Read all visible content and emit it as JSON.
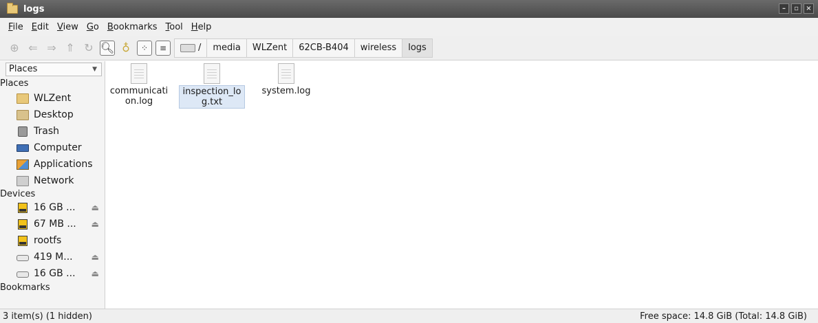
{
  "window": {
    "title": "logs"
  },
  "menu": [
    "File",
    "Edit",
    "View",
    "Go",
    "Bookmarks",
    "Tool",
    "Help"
  ],
  "menu_mnemonics": [
    "F",
    "E",
    "V",
    "G",
    "B",
    "T",
    "H"
  ],
  "breadcrumbs": [
    "/",
    "media",
    "WLZent",
    "62CB-B404",
    "wireless",
    "logs"
  ],
  "sidebar": {
    "selector": "Places",
    "places_header": "Places",
    "places": [
      {
        "label": "WLZent",
        "icon": "home-folder-icon"
      },
      {
        "label": "Desktop",
        "icon": "desktop-folder-icon"
      },
      {
        "label": "Trash",
        "icon": "trash-icon"
      },
      {
        "label": "Computer",
        "icon": "computer-icon"
      },
      {
        "label": "Applications",
        "icon": "applications-icon"
      },
      {
        "label": "Network",
        "icon": "network-folder-icon"
      }
    ],
    "devices_header": "Devices",
    "devices": [
      {
        "label": "16 GB ...",
        "icon": "usb-drive-icon",
        "eject": true
      },
      {
        "label": "67 MB ...",
        "icon": "usb-drive-icon",
        "eject": true
      },
      {
        "label": "rootfs",
        "icon": "usb-drive-icon",
        "eject": false
      },
      {
        "label": "419 M...",
        "icon": "hard-drive-icon",
        "eject": true
      },
      {
        "label": "16 GB ...",
        "icon": "hard-drive-icon",
        "eject": true
      }
    ],
    "bookmarks_header": "Bookmarks"
  },
  "files": [
    {
      "name": "communication.log",
      "display": "communicati on.log",
      "selected": false
    },
    {
      "name": "inspection_log.txt",
      "display": "inspection_lo g.txt",
      "selected": true
    },
    {
      "name": "system.log",
      "display": "system.log",
      "selected": false
    }
  ],
  "status": {
    "left": "3 item(s) (1 hidden)",
    "right": "Free space: 14.8 GiB (Total: 14.8 GiB)"
  }
}
